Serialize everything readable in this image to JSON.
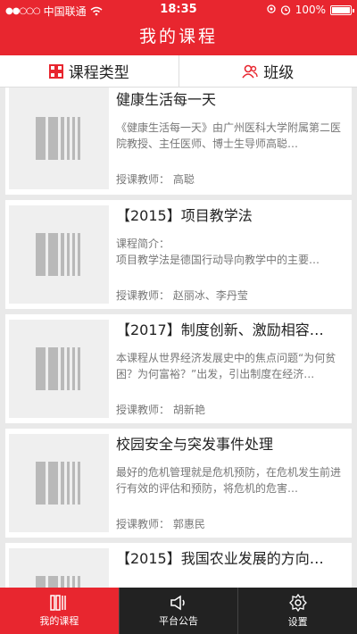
{
  "status_bar": {
    "carrier": "中国联通",
    "time": "18:35",
    "battery": "100%"
  },
  "header": {
    "title": "我的课程"
  },
  "tabs": [
    {
      "label": "课程类型",
      "icon": "grid-icon"
    },
    {
      "label": "班级",
      "icon": "people-icon"
    }
  ],
  "courses": [
    {
      "title": "健康生活每一天",
      "description": "《健康生活每一天》由广州医科大学附属第二医院教授、主任医师、博士生导师高聪…",
      "teacher": "授课教师：  高聪"
    },
    {
      "title": "【2015】项目教学法",
      "description": "课程简介：\n项目教学法是德国行动导向教学中的主要…",
      "teacher": "授课教师：  赵丽冰、李丹莹"
    },
    {
      "title": "【2017】制度创新、激励相容…",
      "description": "本课程从世界经济发展史中的焦点问题“为何贫困？为何富裕？”出发，引出制度在经济…",
      "teacher": "授课教师：  胡新艳"
    },
    {
      "title": "校园安全与突发事件处理",
      "description": "最好的危机管理就是危机预防，在危机发生前进行有效的评估和预防，将危机的危害…",
      "teacher": "授课教师：  郭惠民"
    },
    {
      "title": "【2015】我国农业发展的方向…",
      "description": "",
      "teacher": ""
    }
  ],
  "bottom_nav": [
    {
      "label": "我的课程",
      "icon": "books-icon",
      "active": true
    },
    {
      "label": "平台公告",
      "icon": "speaker-icon",
      "active": false
    },
    {
      "label": "设置",
      "icon": "gear-icon",
      "active": false
    }
  ],
  "colors": {
    "accent": "#e8262f",
    "bottom_bar": "#222222"
  }
}
